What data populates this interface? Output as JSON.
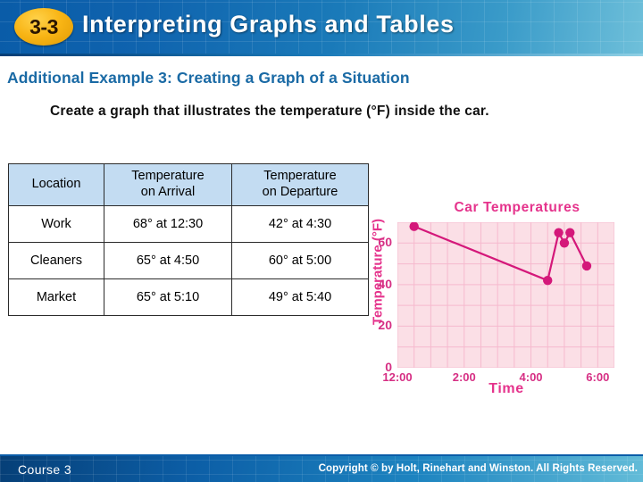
{
  "header": {
    "badge": "3-3",
    "title": "Interpreting Graphs and Tables"
  },
  "subtitle": "Additional Example 3: Creating a Graph of a Situation",
  "prompt": "Create a graph that illustrates the temperature (°F) inside the car.",
  "table": {
    "columns": [
      "Location",
      "Temperature on Arrival",
      "Temperature on Departure"
    ],
    "column_lines": [
      [
        "Location",
        ""
      ],
      [
        "Temperature",
        "on Arrival"
      ],
      [
        "Temperature",
        "on Departure"
      ]
    ],
    "rows": [
      {
        "location": "Work",
        "arrival": "68° at 12:30",
        "departure": "42° at 4:30"
      },
      {
        "location": "Cleaners",
        "arrival": "65° at 4:50",
        "departure": "60° at 5:00"
      },
      {
        "location": "Market",
        "arrival": "65° at 5:10",
        "departure": "49° at 5:40"
      }
    ]
  },
  "chart_data": {
    "type": "line",
    "title": "Car Temperatures",
    "xlabel": "Time",
    "ylabel": "Temperature (°F)",
    "xlim": [
      12.0,
      18.5
    ],
    "ylim": [
      0,
      70
    ],
    "xtick_labels": [
      "12:00",
      "2:00",
      "4:00",
      "6:00"
    ],
    "xtick_values": [
      12,
      14,
      16,
      18
    ],
    "ytick_labels": [
      "0",
      "20",
      "40",
      "60"
    ],
    "ytick_values": [
      0,
      20,
      40,
      60
    ],
    "grid": true,
    "grid_x_step": 0.5,
    "grid_y_step": 10,
    "legend": "none",
    "series": [
      {
        "name": "Car Temperature",
        "color": "#d4187a",
        "points": [
          {
            "time": "12:30",
            "x": 12.5,
            "y": 68,
            "label": "68° at 12:30"
          },
          {
            "time": "4:30",
            "x": 16.5,
            "y": 42,
            "label": "42° at 4:30"
          },
          {
            "time": "4:50",
            "x": 16.83,
            "y": 65,
            "label": "65° at 4:50"
          },
          {
            "time": "5:00",
            "x": 17.0,
            "y": 60,
            "label": "60° at 5:00"
          },
          {
            "time": "5:10",
            "x": 17.17,
            "y": 65,
            "label": "65° at 5:10"
          },
          {
            "time": "5:40",
            "x": 17.67,
            "y": 49,
            "label": "49° at 5:40"
          }
        ]
      }
    ]
  },
  "footer": {
    "course": "Course 3",
    "copyright": "Copyright © by Holt, Rinehart and Winston. All Rights Reserved."
  }
}
